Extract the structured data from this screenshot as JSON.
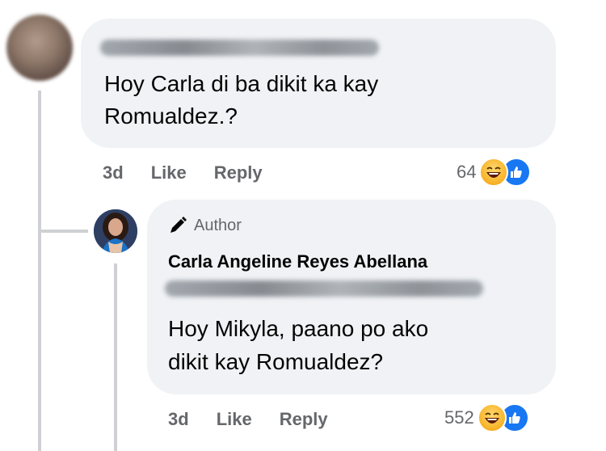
{
  "comment": {
    "text_line1": "Hoy Carla di ba dikit ka kay",
    "text_line2": "Romualdez.?",
    "time": "3d",
    "like_label": "Like",
    "reply_label": "Reply",
    "reaction_count": "64"
  },
  "reply": {
    "badge": "Author",
    "author": "Carla Angeline Reyes Abellana",
    "text_line1": "Hoy Mikyla, paano po ako",
    "text_line2": "dikit kay Romualdez?",
    "time": "3d",
    "like_label": "Like",
    "reply_label": "Reply",
    "reaction_count": "552"
  },
  "colors": {
    "bubble": "#f0f2f5",
    "secondary_text": "#65676b",
    "like_blue": "#1877f2",
    "haha_yellow": "#f7b125"
  },
  "icons": [
    "pencil-icon",
    "haha-reaction-icon",
    "like-reaction-icon"
  ]
}
